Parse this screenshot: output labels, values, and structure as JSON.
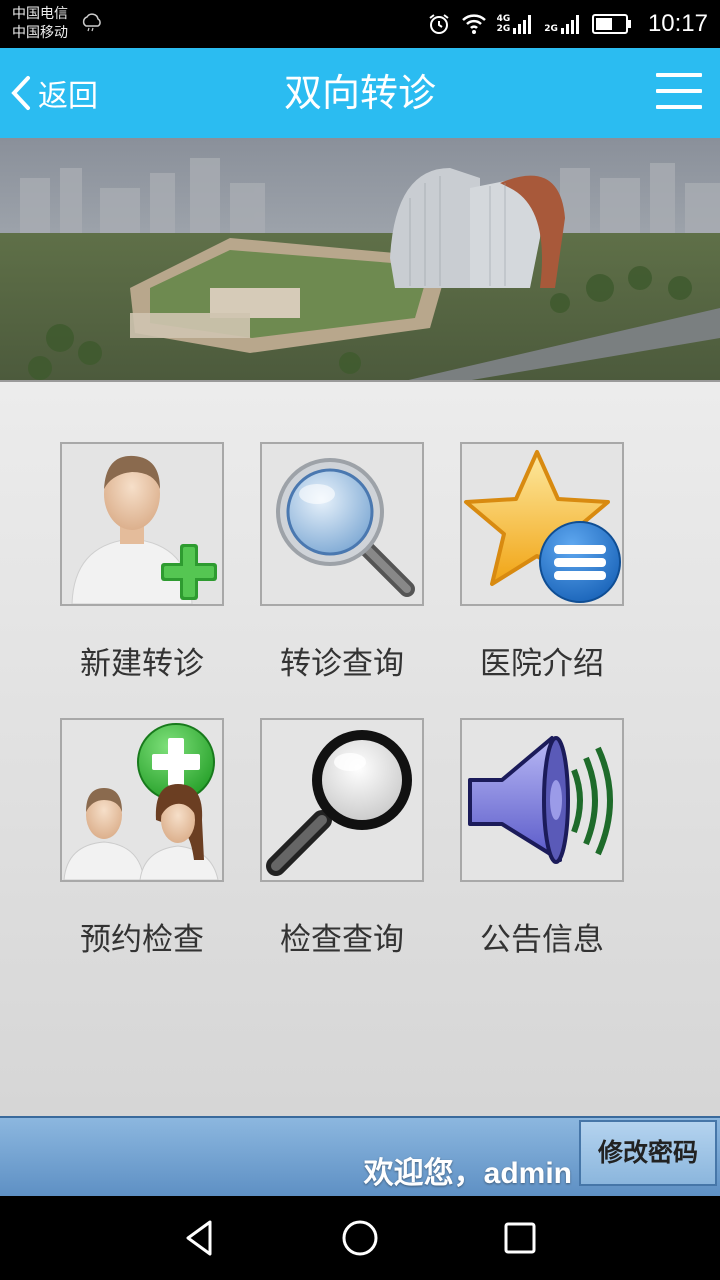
{
  "status_bar": {
    "carrier1": "中国电信",
    "carrier2": "中国移动",
    "network1": "4G",
    "network1b": "2G",
    "network2": "2G",
    "time": "10:17"
  },
  "header": {
    "back_label": "返回",
    "title": "双向转诊",
    "bg_color": "#2bbcf1"
  },
  "grid": {
    "items": [
      {
        "label": "新建转诊",
        "icon": "person-add-icon"
      },
      {
        "label": "转诊查询",
        "icon": "magnifier-icon"
      },
      {
        "label": "医院介绍",
        "icon": "star-list-icon"
      },
      {
        "label": "预约检查",
        "icon": "people-add-icon"
      },
      {
        "label": "检查查询",
        "icon": "search-icon"
      },
      {
        "label": "公告信息",
        "icon": "speaker-icon"
      }
    ]
  },
  "footer": {
    "welcome": "欢迎您，admin",
    "change_password": "修改密码"
  }
}
